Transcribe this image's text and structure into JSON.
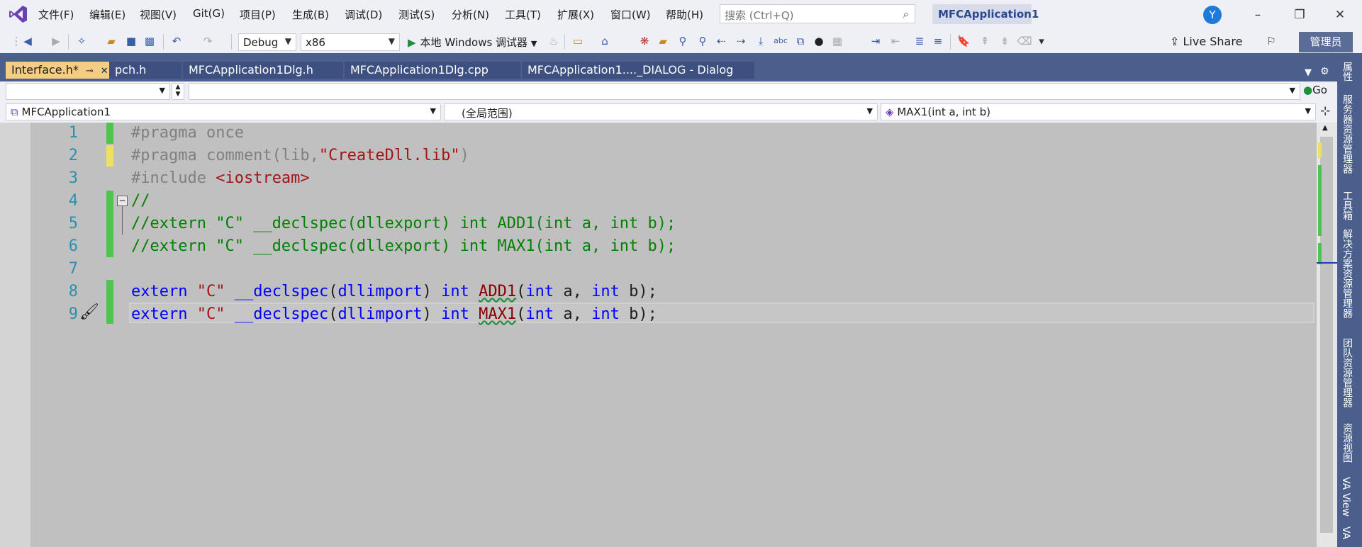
{
  "menubar": {
    "items": [
      "文件(F)",
      "编辑(E)",
      "视图(V)",
      "Git(G)",
      "项目(P)",
      "生成(B)",
      "调试(D)",
      "测试(S)",
      "分析(N)",
      "工具(T)",
      "扩展(X)",
      "窗口(W)",
      "帮助(H)"
    ],
    "search_placeholder": "搜索 (Ctrl+Q)",
    "window_title": "MFCApplication1",
    "avatar_letter": "Y"
  },
  "toolbar": {
    "config": "Debug",
    "platform": "x86",
    "run_label": "本地 Windows 调试器",
    "live_share": "Live Share",
    "admin": "管理员"
  },
  "tabs": [
    {
      "label": "Interface.h*",
      "active": true
    },
    {
      "label": "pch.h",
      "active": false
    },
    {
      "label": "MFCApplication1Dlg.h",
      "active": false
    },
    {
      "label": "MFCApplication1Dlg.cpp",
      "active": false
    },
    {
      "label": "MFCApplication1...._DIALOG - Dialog",
      "active": false
    }
  ],
  "nav": {
    "go_label": "Go",
    "project": "MFCApplication1",
    "scope": "(全局范围)",
    "member": "MAX1(int a, int b)"
  },
  "editor": {
    "line_numbers": [
      "1",
      "2",
      "3",
      "4",
      "5",
      "6",
      "7",
      "8",
      "9"
    ],
    "lines": {
      "l1_pp": "#pragma once",
      "l2_pp1": "#pragma comment(lib,",
      "l2_str": "\"CreateDll.lib\"",
      "l2_pp2": ")",
      "l3_pp": "#include ",
      "l3_str": "<iostream>",
      "l4_cmt": "//",
      "l5_cmt": "//extern \"C\" __declspec(dllexport) int ADD1(int a, int b);",
      "l6_cmt": "//extern \"C\" __declspec(dllexport) int MAX1(int a, int b);",
      "l8_kw1": "extern",
      "l8_str": "\"C\"",
      "l8_kw2": "__declspec",
      "l8_p1": "(",
      "l8_kw3": "dllimport",
      "l8_p2": ")",
      "l8_kw4": "int",
      "l8_fn": "ADD1",
      "l8_p3": "(",
      "l8_kw5": "int",
      "l8_a": "a,",
      "l8_kw6": "int",
      "l8_b": "b);",
      "l9_kw1": "extern",
      "l9_str": "\"C\"",
      "l9_kw2": "__declspec",
      "l9_p1": "(",
      "l9_kw3": "dllimport",
      "l9_p2": ")",
      "l9_kw4": "int",
      "l9_fn": "MAX1",
      "l9_p3": "(",
      "l9_kw5": "int",
      "l9_a": "a,",
      "l9_kw6": "int",
      "l9_b": "b);"
    },
    "collapse_glyph": "−"
  },
  "side_panels": [
    "属性",
    "服务器资源管理器",
    "工具箱",
    "解决方案资源管理器",
    "团队资源管理器",
    "资源视图",
    "VA View",
    "VA"
  ],
  "icons": [
    "visual-studio-logo-icon",
    "search-icon",
    "back-icon",
    "forward-icon",
    "new-project-icon",
    "open-icon",
    "save-icon",
    "save-all-icon",
    "undo-icon",
    "redo-icon",
    "run-icon",
    "live-share-icon",
    "feedback-icon",
    "pin-icon",
    "close-icon",
    "gear-icon",
    "brush-icon"
  ],
  "colors": {
    "accent_tab": "#f5cc84",
    "tab_bar": "#4a5f8c",
    "editor_bg": "#c0c0c0",
    "keyword": "#0000ff",
    "string": "#a31515",
    "comment": "#008000",
    "preprocessor": "#808080",
    "line_number": "#2b91af"
  }
}
